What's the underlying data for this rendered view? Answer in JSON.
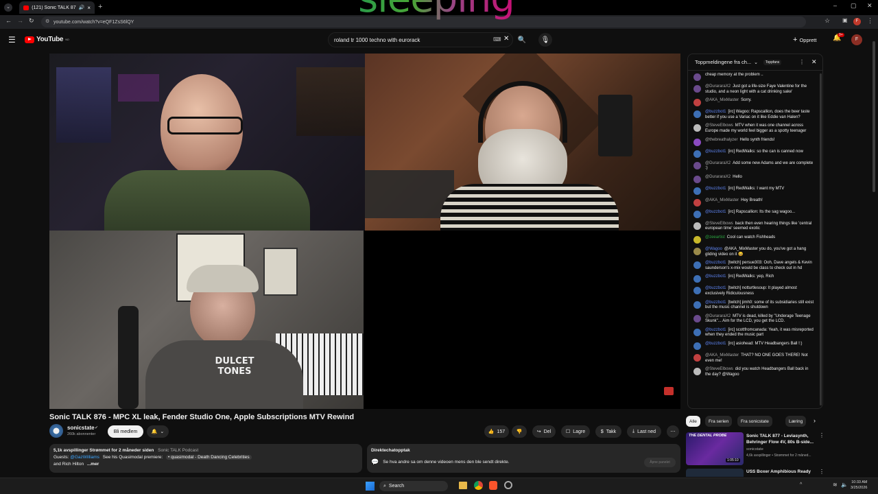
{
  "browser": {
    "tab_title": "(121) Sonic TALK 876 - MPC",
    "url": "youtube.com/watch?v=eQF1ZsS6lQY"
  },
  "header": {
    "logo": "YouTube",
    "logo_region": "NO",
    "search_query": "roland tr 1000 techno with eurorack",
    "create_label": "Opprett",
    "notif_count": "9+",
    "avatar_letter": "F",
    "overlay_word": "sleeping"
  },
  "chat": {
    "header_label": "Toppmeldingene fra ch...",
    "top_fan_label": "Toppfans",
    "messages": [
      {
        "author": "",
        "text": "cheap memory at the problem ..",
        "color": "#6a4a8c",
        "type": "plain"
      },
      {
        "author": "@DurararaX2",
        "text": "Just got a life-size Faye Valentine for the studio, and a neon light with a cat drinking sake'",
        "color": "#6a4a8c",
        "type": "plain"
      },
      {
        "author": "@AKA_MixMaster",
        "text": "Sorry.",
        "color": "#c04040",
        "type": "plain"
      },
      {
        "author": "@buzzbot1",
        "text": "[irc] Wagoo: Rapscallion, does the beer taste better if you use a Variac on it like Eddie van Halen?",
        "color": "#3d6fb5",
        "type": "mod"
      },
      {
        "author": "@SteveElbows",
        "text": "MTV when it was one channel across Europe made my world feel bigger as a spotty teenager",
        "color": "#bbbbbb",
        "type": "plain"
      },
      {
        "author": "@thebreathalyzer",
        "text": "Hello synth friends!",
        "color": "#8a4ac0",
        "type": "plain"
      },
      {
        "author": "@buzzbot1",
        "text": "[irc] RedWalks: so the can is canned now",
        "color": "#3d6fb5",
        "type": "mod"
      },
      {
        "author": "@DurararaX2",
        "text": "Add some new Adams and we are complete :)",
        "color": "#6a4a8c",
        "type": "plain"
      },
      {
        "author": "@DurararaX2",
        "text": "Hello",
        "color": "#6a4a8c",
        "type": "plain"
      },
      {
        "author": "@buzzbot1",
        "text": "[irc] RedWalks: I want my MTV",
        "color": "#3d6fb5",
        "type": "mod"
      },
      {
        "author": "@AKA_MixMaster",
        "text": "Hey Breath!",
        "color": "#c04040",
        "type": "plain"
      },
      {
        "author": "@buzzbot1",
        "text": "[irc] Rapscallion: Its the sag wagoo...",
        "color": "#3d6fb5",
        "type": "mod"
      },
      {
        "author": "@SteveElbows",
        "text": "back then even hearing things like 'central european time' seemed exotic",
        "color": "#bbbbbb",
        "type": "plain"
      },
      {
        "author": "@zeeartist",
        "text": "Cool can watch Fishheads",
        "color": "#c8b82a",
        "type": "mem"
      },
      {
        "author": "@Wagoo",
        "text": "@AKA_MixMaster you do, you've got a hang gliding video on it 😀",
        "color": "#9a8a4a",
        "type": "mod"
      },
      {
        "author": "@buzzbot1",
        "text": "[twitch] persue303: Ooh, Dave angels & Kevin saunderson's x-mix would be class to check out in hd",
        "color": "#3d6fb5",
        "type": "mod"
      },
      {
        "author": "@buzzbot1",
        "text": "[irc] RedWalks: yep, Rich",
        "color": "#3d6fb5",
        "type": "mod"
      },
      {
        "author": "@buzzbot1",
        "text": "[twitch] notturtlesoup: It played almost exclusively Ridiculousness",
        "color": "#3d6fb5",
        "type": "mod"
      },
      {
        "author": "@buzzbot1",
        "text": "[twitch] jimh0: some of its subsidiaries still exist but the music channel is shutdown",
        "color": "#3d6fb5",
        "type": "mod"
      },
      {
        "author": "@DurararaX2",
        "text": "MTV is dead, killed by \"Underage Teenage Skunk\"... Aim for the LCD, you get the LCD.",
        "color": "#6a4a8c",
        "type": "plain"
      },
      {
        "author": "@buzzbot1",
        "text": "[irc] scottfromcanada: Yeah, it was misreported when they ended the music part",
        "color": "#3d6fb5",
        "type": "mod"
      },
      {
        "author": "@buzzbot1",
        "text": "[irc] asiohead: MTV Headbangers Ball !:)",
        "color": "#3d6fb5",
        "type": "mod"
      },
      {
        "author": "@AKA_MixMaster",
        "text": "THAT? NO ONE GOES THERE! Not even me!",
        "color": "#c04040",
        "type": "plain"
      },
      {
        "author": "@SteveElbows",
        "text": "did you watch Headbangers Ball back in the day? @Wagoo",
        "color": "#bbbbbb",
        "type": "plain"
      }
    ]
  },
  "video": {
    "title": "Sonic TALK 876 - MPC XL leak, Fender Studio One, Apple Subscriptions MTV Rewind",
    "channel": "sonicstate",
    "subscribers": "260k abonnenter",
    "member_button": "Bli medlem",
    "likes": "157",
    "share": "Del",
    "save": "Lagre",
    "thanks": "Takk",
    "download": "Last ned",
    "shirt_text_1": "DULCET",
    "shirt_text_2": "TONES"
  },
  "description": {
    "stats": "5,1k avspillinger  Strømmet for 2 måneder siden",
    "podcast_link": "Sonic TALK Podcast",
    "guests_label": "Guests:",
    "guest1": "@GazWilliams",
    "guest1_text": "See his Quasimodal premiere:",
    "quasimodal": "• quasimodal - Death Dancing Celebrities",
    "line3": "and Rich Hilton",
    "more": "...mer"
  },
  "replay": {
    "title": "Direktechatopptak",
    "text": "Se hva andre sa om denne videoen mens den ble sendt direkte.",
    "button": "Åpne panelet"
  },
  "recs": {
    "chips": [
      "Alle",
      "Fra serien",
      "Fra sonicstate",
      "Læring"
    ],
    "items": [
      {
        "title": "Sonic TALK 877 - Leviasynth, Behringer Flow 4V, 80s B-side...",
        "channel": "sonicstate",
        "meta": "4,6k avspillinger • Strømmet for 2 måned...",
        "duration": "1:05:10",
        "thumb_text": "THE DENTAL PROBE"
      },
      {
        "title": "USS Boxer Amphibious Ready",
        "channel": "",
        "meta": "",
        "duration": "",
        "thumb_text": ""
      }
    ]
  },
  "taskbar": {
    "search": "Search",
    "time": "10:33 AM",
    "date": "3/25/2026"
  }
}
